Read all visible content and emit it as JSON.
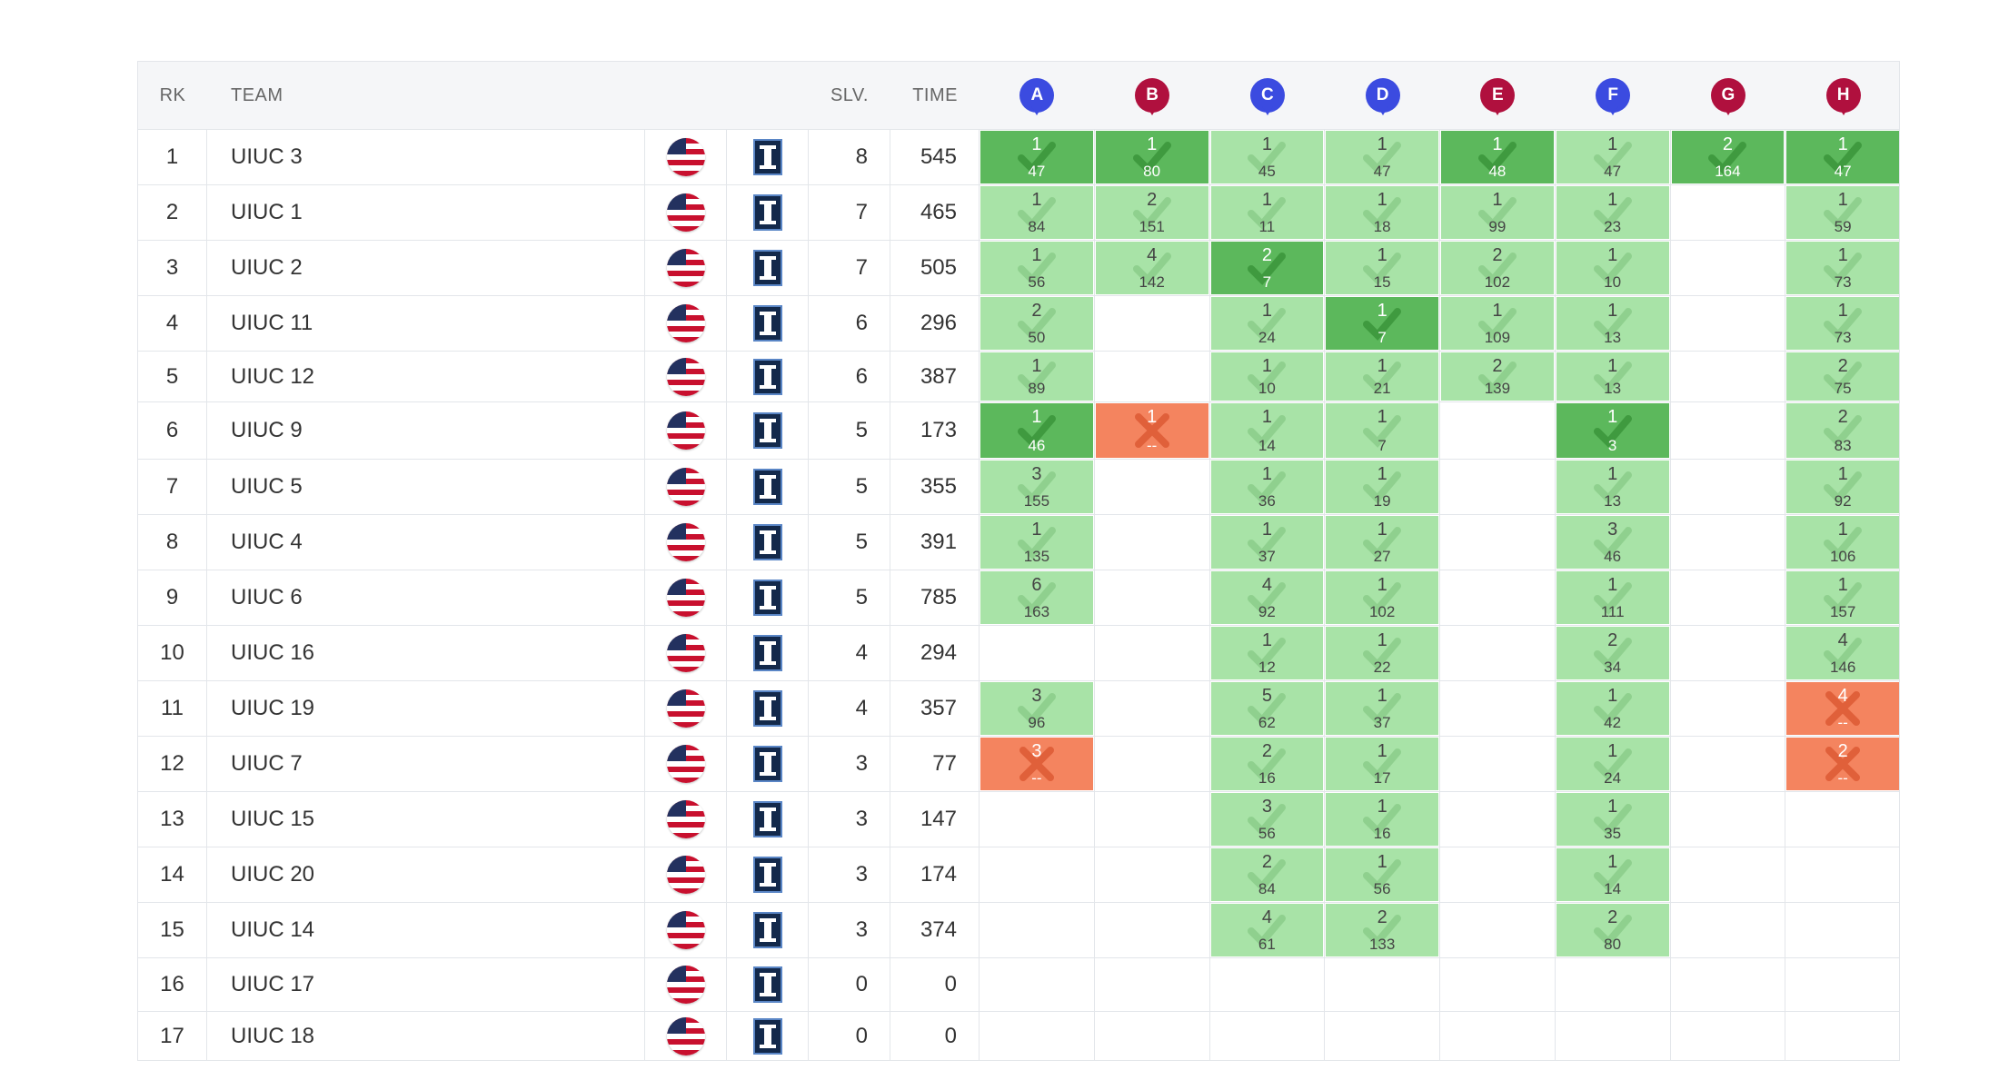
{
  "header": {
    "rank": "RK",
    "team": "TEAM",
    "solved": "SLV.",
    "time": "TIME"
  },
  "problems": [
    {
      "label": "A",
      "color": "#3b4be0"
    },
    {
      "label": "B",
      "color": "#b0103e"
    },
    {
      "label": "C",
      "color": "#3b4be0"
    },
    {
      "label": "D",
      "color": "#3b4be0"
    },
    {
      "label": "E",
      "color": "#b0103e"
    },
    {
      "label": "F",
      "color": "#3b4be0"
    },
    {
      "label": "G",
      "color": "#b0103e"
    },
    {
      "label": "H",
      "color": "#b0103e"
    }
  ],
  "icons": {
    "country": "us-flag-icon",
    "affiliation": "university-logo-icon",
    "check": "check-icon",
    "cross": "cross-icon"
  },
  "rows": [
    {
      "rank": "1",
      "team": "UIUC 3",
      "solved": "8",
      "time": "545",
      "cells": [
        {
          "s": "first",
          "a": "1",
          "t": "47"
        },
        {
          "s": "first",
          "a": "1",
          "t": "80"
        },
        {
          "s": "solved",
          "a": "1",
          "t": "45"
        },
        {
          "s": "solved",
          "a": "1",
          "t": "47"
        },
        {
          "s": "first",
          "a": "1",
          "t": "48"
        },
        {
          "s": "solved",
          "a": "1",
          "t": "47"
        },
        {
          "s": "first",
          "a": "2",
          "t": "164"
        },
        {
          "s": "first",
          "a": "1",
          "t": "47"
        }
      ]
    },
    {
      "rank": "2",
      "team": "UIUC 1",
      "solved": "7",
      "time": "465",
      "cells": [
        {
          "s": "solved",
          "a": "1",
          "t": "84"
        },
        {
          "s": "solved",
          "a": "2",
          "t": "151"
        },
        {
          "s": "solved",
          "a": "1",
          "t": "11"
        },
        {
          "s": "solved",
          "a": "1",
          "t": "18"
        },
        {
          "s": "solved",
          "a": "1",
          "t": "99"
        },
        {
          "s": "solved",
          "a": "1",
          "t": "23"
        },
        {
          "s": "none"
        },
        {
          "s": "solved",
          "a": "1",
          "t": "59"
        }
      ]
    },
    {
      "rank": "3",
      "team": "UIUC 2",
      "solved": "7",
      "time": "505",
      "cells": [
        {
          "s": "solved",
          "a": "1",
          "t": "56"
        },
        {
          "s": "solved",
          "a": "4",
          "t": "142"
        },
        {
          "s": "first",
          "a": "2",
          "t": "7"
        },
        {
          "s": "solved",
          "a": "1",
          "t": "15"
        },
        {
          "s": "solved",
          "a": "2",
          "t": "102"
        },
        {
          "s": "solved",
          "a": "1",
          "t": "10"
        },
        {
          "s": "none"
        },
        {
          "s": "solved",
          "a": "1",
          "t": "73"
        }
      ]
    },
    {
      "rank": "4",
      "team": "UIUC 11",
      "solved": "6",
      "time": "296",
      "cells": [
        {
          "s": "solved",
          "a": "2",
          "t": "50"
        },
        {
          "s": "none"
        },
        {
          "s": "solved",
          "a": "1",
          "t": "24"
        },
        {
          "s": "first",
          "a": "1",
          "t": "7"
        },
        {
          "s": "solved",
          "a": "1",
          "t": "109"
        },
        {
          "s": "solved",
          "a": "1",
          "t": "13"
        },
        {
          "s": "none"
        },
        {
          "s": "solved",
          "a": "1",
          "t": "73"
        }
      ]
    },
    {
      "rank": "5",
      "team": "UIUC 12",
      "solved": "6",
      "time": "387",
      "cells": [
        {
          "s": "solved",
          "a": "1",
          "t": "89"
        },
        {
          "s": "none"
        },
        {
          "s": "solved",
          "a": "1",
          "t": "10"
        },
        {
          "s": "solved",
          "a": "1",
          "t": "21"
        },
        {
          "s": "solved",
          "a": "2",
          "t": "139"
        },
        {
          "s": "solved",
          "a": "1",
          "t": "13"
        },
        {
          "s": "none"
        },
        {
          "s": "solved",
          "a": "2",
          "t": "75"
        }
      ]
    },
    {
      "rank": "6",
      "team": "UIUC 9",
      "solved": "5",
      "time": "173",
      "cells": [
        {
          "s": "first",
          "a": "1",
          "t": "46"
        },
        {
          "s": "failed",
          "a": "1",
          "t": "--"
        },
        {
          "s": "solved",
          "a": "1",
          "t": "14"
        },
        {
          "s": "solved",
          "a": "1",
          "t": "7"
        },
        {
          "s": "none"
        },
        {
          "s": "first",
          "a": "1",
          "t": "3"
        },
        {
          "s": "none"
        },
        {
          "s": "solved",
          "a": "2",
          "t": "83"
        }
      ]
    },
    {
      "rank": "7",
      "team": "UIUC 5",
      "solved": "5",
      "time": "355",
      "cells": [
        {
          "s": "solved",
          "a": "3",
          "t": "155"
        },
        {
          "s": "none"
        },
        {
          "s": "solved",
          "a": "1",
          "t": "36"
        },
        {
          "s": "solved",
          "a": "1",
          "t": "19"
        },
        {
          "s": "none"
        },
        {
          "s": "solved",
          "a": "1",
          "t": "13"
        },
        {
          "s": "none"
        },
        {
          "s": "solved",
          "a": "1",
          "t": "92"
        }
      ]
    },
    {
      "rank": "8",
      "team": "UIUC 4",
      "solved": "5",
      "time": "391",
      "cells": [
        {
          "s": "solved",
          "a": "1",
          "t": "135"
        },
        {
          "s": "none"
        },
        {
          "s": "solved",
          "a": "1",
          "t": "37"
        },
        {
          "s": "solved",
          "a": "1",
          "t": "27"
        },
        {
          "s": "none"
        },
        {
          "s": "solved",
          "a": "3",
          "t": "46"
        },
        {
          "s": "none"
        },
        {
          "s": "solved",
          "a": "1",
          "t": "106"
        }
      ]
    },
    {
      "rank": "9",
      "team": "UIUC 6",
      "solved": "5",
      "time": "785",
      "cells": [
        {
          "s": "solved",
          "a": "6",
          "t": "163"
        },
        {
          "s": "none"
        },
        {
          "s": "solved",
          "a": "4",
          "t": "92"
        },
        {
          "s": "solved",
          "a": "1",
          "t": "102"
        },
        {
          "s": "none"
        },
        {
          "s": "solved",
          "a": "1",
          "t": "111"
        },
        {
          "s": "none"
        },
        {
          "s": "solved",
          "a": "1",
          "t": "157"
        }
      ]
    },
    {
      "rank": "10",
      "team": "UIUC 16",
      "solved": "4",
      "time": "294",
      "cells": [
        {
          "s": "none"
        },
        {
          "s": "none"
        },
        {
          "s": "solved",
          "a": "1",
          "t": "12"
        },
        {
          "s": "solved",
          "a": "1",
          "t": "22"
        },
        {
          "s": "none"
        },
        {
          "s": "solved",
          "a": "2",
          "t": "34"
        },
        {
          "s": "none"
        },
        {
          "s": "solved",
          "a": "4",
          "t": "146"
        }
      ]
    },
    {
      "rank": "11",
      "team": "UIUC 19",
      "solved": "4",
      "time": "357",
      "cells": [
        {
          "s": "solved",
          "a": "3",
          "t": "96"
        },
        {
          "s": "none"
        },
        {
          "s": "solved",
          "a": "5",
          "t": "62"
        },
        {
          "s": "solved",
          "a": "1",
          "t": "37"
        },
        {
          "s": "none"
        },
        {
          "s": "solved",
          "a": "1",
          "t": "42"
        },
        {
          "s": "none"
        },
        {
          "s": "failed",
          "a": "4",
          "t": "--"
        }
      ]
    },
    {
      "rank": "12",
      "team": "UIUC 7",
      "solved": "3",
      "time": "77",
      "cells": [
        {
          "s": "failed",
          "a": "3",
          "t": "--"
        },
        {
          "s": "none"
        },
        {
          "s": "solved",
          "a": "2",
          "t": "16"
        },
        {
          "s": "solved",
          "a": "1",
          "t": "17"
        },
        {
          "s": "none"
        },
        {
          "s": "solved",
          "a": "1",
          "t": "24"
        },
        {
          "s": "none"
        },
        {
          "s": "failed",
          "a": "2",
          "t": "--"
        }
      ]
    },
    {
      "rank": "13",
      "team": "UIUC 15",
      "solved": "3",
      "time": "147",
      "cells": [
        {
          "s": "none"
        },
        {
          "s": "none"
        },
        {
          "s": "solved",
          "a": "3",
          "t": "56"
        },
        {
          "s": "solved",
          "a": "1",
          "t": "16"
        },
        {
          "s": "none"
        },
        {
          "s": "solved",
          "a": "1",
          "t": "35"
        },
        {
          "s": "none"
        },
        {
          "s": "none"
        }
      ]
    },
    {
      "rank": "14",
      "team": "UIUC 20",
      "solved": "3",
      "time": "174",
      "cells": [
        {
          "s": "none"
        },
        {
          "s": "none"
        },
        {
          "s": "solved",
          "a": "2",
          "t": "84"
        },
        {
          "s": "solved",
          "a": "1",
          "t": "56"
        },
        {
          "s": "none"
        },
        {
          "s": "solved",
          "a": "1",
          "t": "14"
        },
        {
          "s": "none"
        },
        {
          "s": "none"
        }
      ]
    },
    {
      "rank": "15",
      "team": "UIUC 14",
      "solved": "3",
      "time": "374",
      "cells": [
        {
          "s": "none"
        },
        {
          "s": "none"
        },
        {
          "s": "solved",
          "a": "4",
          "t": "61"
        },
        {
          "s": "solved",
          "a": "2",
          "t": "133"
        },
        {
          "s": "none"
        },
        {
          "s": "solved",
          "a": "2",
          "t": "80"
        },
        {
          "s": "none"
        },
        {
          "s": "none"
        }
      ]
    },
    {
      "rank": "16",
      "team": "UIUC 17",
      "solved": "0",
      "time": "0",
      "cells": [
        {
          "s": "none"
        },
        {
          "s": "none"
        },
        {
          "s": "none"
        },
        {
          "s": "none"
        },
        {
          "s": "none"
        },
        {
          "s": "none"
        },
        {
          "s": "none"
        },
        {
          "s": "none"
        }
      ]
    },
    {
      "rank": "17",
      "team": "UIUC 18",
      "solved": "0",
      "time": "0",
      "cells": [
        {
          "s": "none"
        },
        {
          "s": "none"
        },
        {
          "s": "none"
        },
        {
          "s": "none"
        },
        {
          "s": "none"
        },
        {
          "s": "none"
        },
        {
          "s": "none"
        },
        {
          "s": "none"
        }
      ]
    }
  ]
}
